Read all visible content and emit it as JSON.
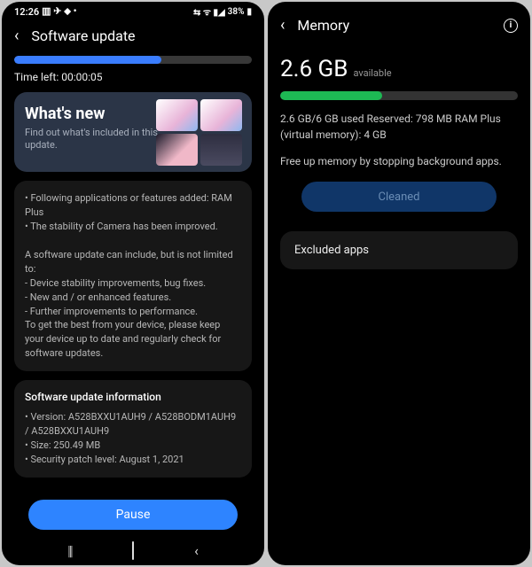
{
  "left": {
    "statusbar": {
      "time": "12:26",
      "battery": "38%"
    },
    "title": "Software update",
    "progress_pct": 62,
    "time_left": "Time left: 00:00:05",
    "whats_new": {
      "title": "What's new",
      "subtitle": "Find out what's included in this update."
    },
    "details": "• Following applications or features added: RAM Plus\n• The stability of Camera has been improved.\n\nA software update can include, but is not limited to:\n - Device stability improvements, bug fixes.\n - New and / or enhanced features.\n - Further improvements to performance.\nTo get the best from your device, please keep your device up to date and regularly check for software updates.",
    "info_heading": "Software update information",
    "info_body": "• Version: A528BXXU1AUH9 / A528BODM1AUH9 / A528BXXU1AUH9\n• Size: 250.49 MB\n• Security patch level: August 1, 2021",
    "pause_label": "Pause"
  },
  "right": {
    "title": "Memory",
    "available_value": "2.6 GB",
    "available_label": "available",
    "mem_used_pct": 43,
    "stats": "2.6 GB/6 GB used\nReserved: 798 MB\nRAM Plus (virtual memory): 4 GB",
    "hint": "Free up memory by stopping background apps.",
    "cleaned_label": "Cleaned",
    "excluded_label": "Excluded apps"
  }
}
